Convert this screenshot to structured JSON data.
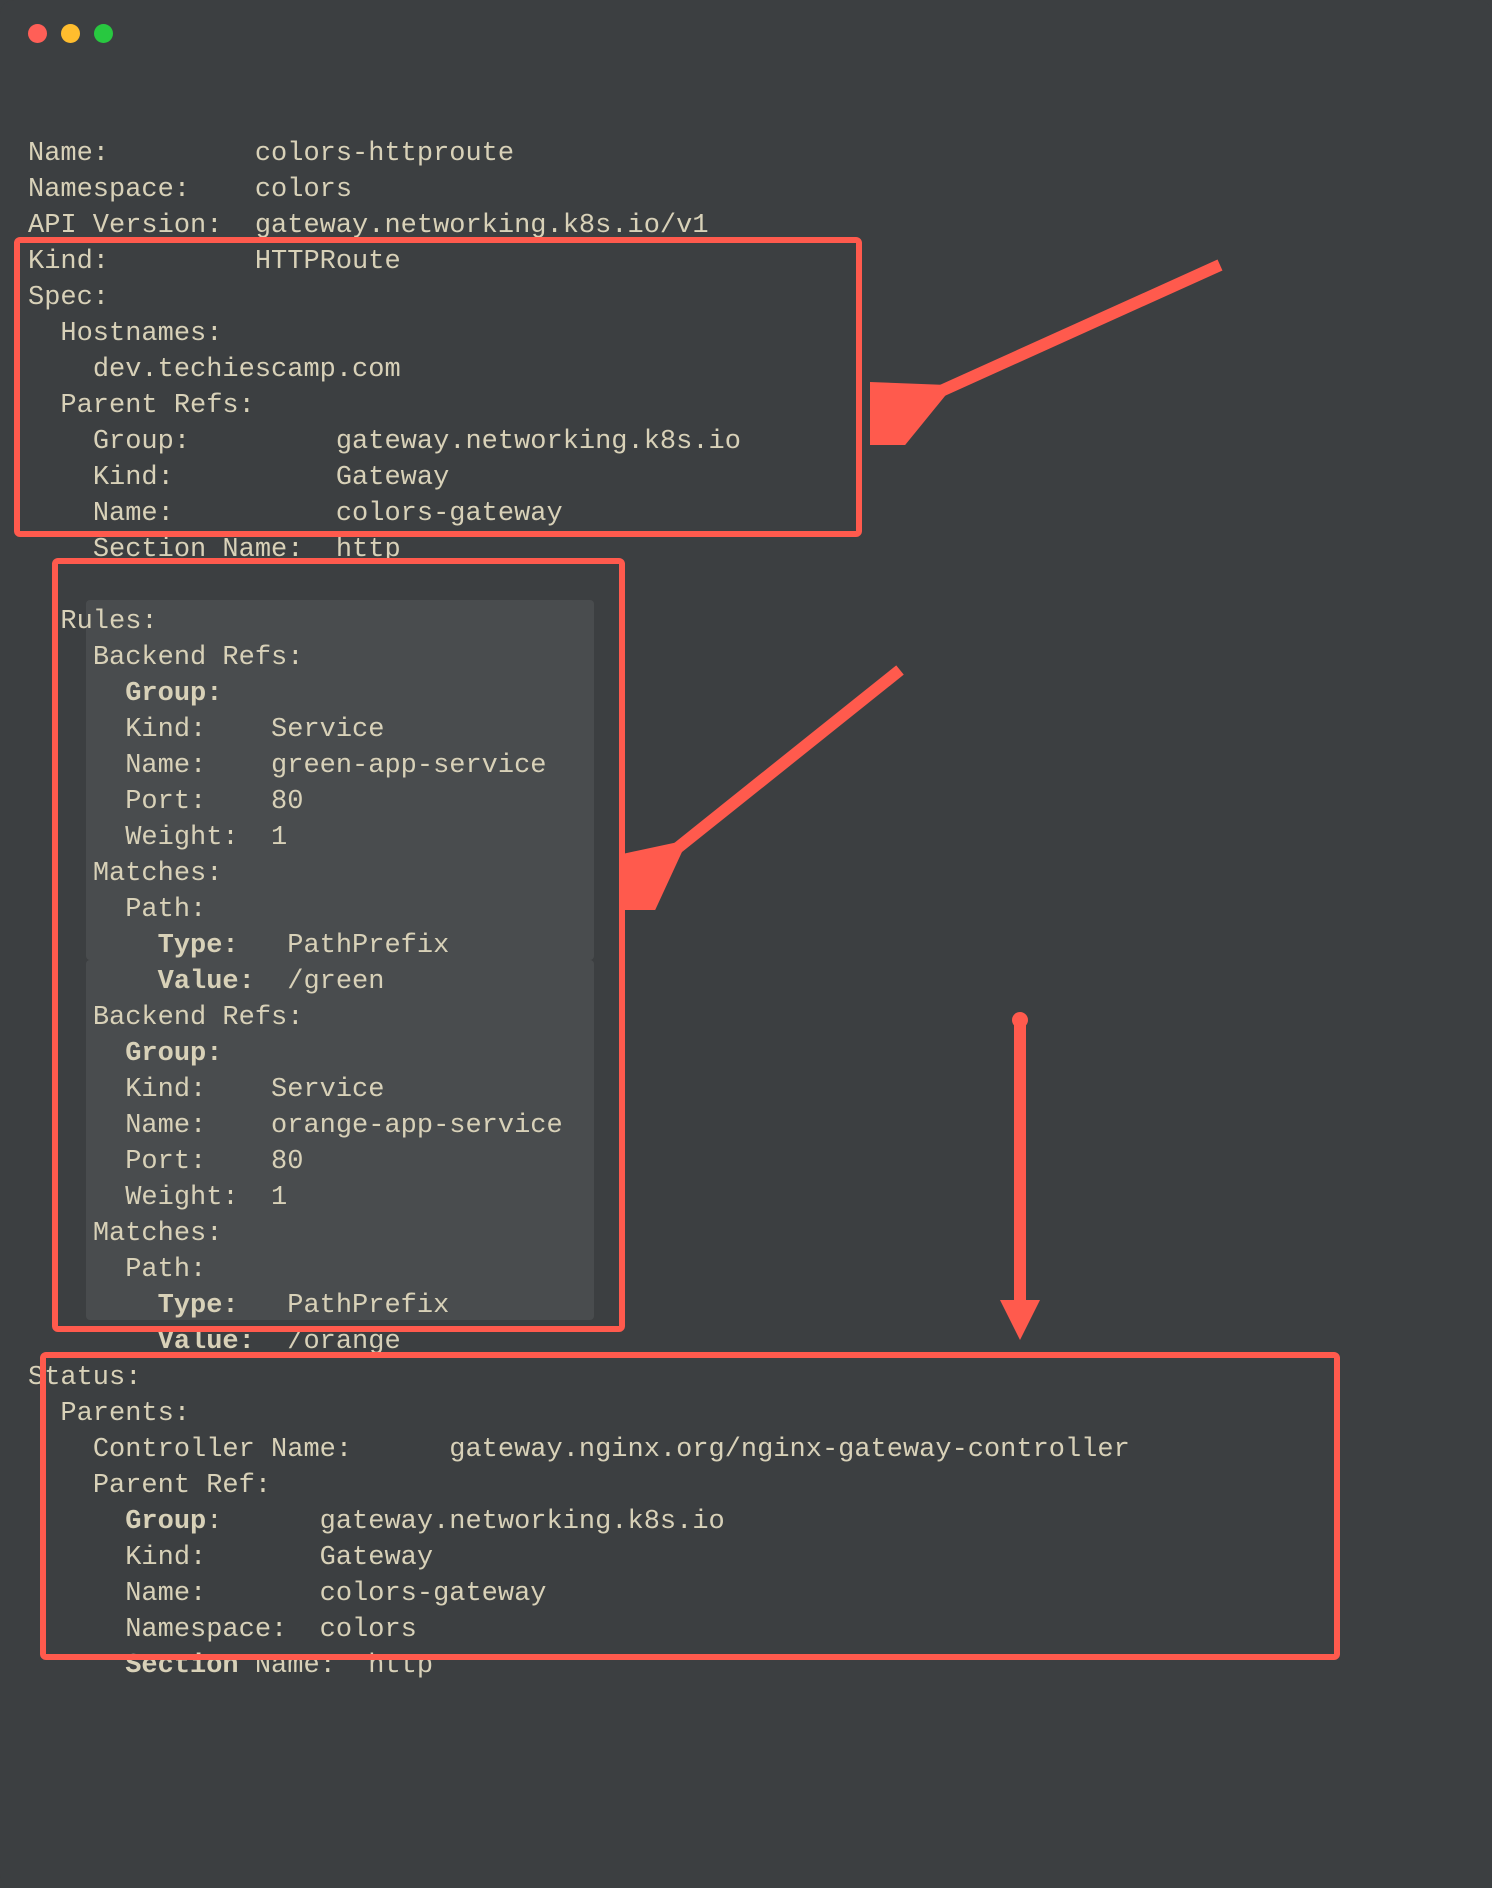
{
  "header": {
    "name_label": "Name:",
    "name_value": "colors-httproute",
    "namespace_label": "Namespace:",
    "namespace_value": "colors",
    "api_version_label": "API Version:",
    "api_version_value": "gateway.networking.k8s.io/v1",
    "kind_label": "Kind:",
    "kind_value": "HTTPRoute"
  },
  "spec": {
    "title": "Spec:",
    "hostnames_label": "Hostnames:",
    "hostnames_value": "dev.techiescamp.com",
    "parent_refs_label": "Parent Refs:",
    "parent_refs": {
      "group_label": "Group:",
      "group_value": "gateway.networking.k8s.io",
      "kind_label": "Kind:",
      "kind_value": "Gateway",
      "name_label": "Name:",
      "name_value": "colors-gateway",
      "section_name_label": "Section Name:",
      "section_name_value": "http"
    }
  },
  "rules": {
    "title": "Rules:",
    "items": [
      {
        "backend_refs_label": "Backend Refs:",
        "group_label": "Group:",
        "kind_label": "Kind:",
        "kind_value": "Service",
        "name_label": "Name:",
        "name_value": "green-app-service",
        "port_label": "Port:",
        "port_value": "80",
        "weight_label": "Weight:",
        "weight_value": "1",
        "matches_label": "Matches:",
        "path_label": "Path:",
        "type_label": "Type:",
        "type_value": "PathPrefix",
        "value_label": "Value:",
        "value_value": "/green"
      },
      {
        "backend_refs_label": "Backend Refs:",
        "group_label": "Group:",
        "kind_label": "Kind:",
        "kind_value": "Service",
        "name_label": "Name:",
        "name_value": "orange-app-service",
        "port_label": "Port:",
        "port_value": "80",
        "weight_label": "Weight:",
        "weight_value": "1",
        "matches_label": "Matches:",
        "path_label": "Path:",
        "type_label": "Type:",
        "type_value": "PathPrefix",
        "value_label": "Value:",
        "value_value": "/orange"
      }
    ]
  },
  "status": {
    "title": "Status:",
    "parents_label": "Parents:",
    "controller_name_label": "Controller Name:",
    "controller_name_value": "gateway.nginx.org/nginx-gateway-controller",
    "parent_ref_label": "Parent Ref:",
    "parent_ref": {
      "group_label": "Group",
      "group_colon": ":",
      "group_value": "gateway.networking.k8s.io",
      "kind_label": "Kind:",
      "kind_value": "Gateway",
      "name_label": "Name:",
      "name_value": "colors-gateway",
      "namespace_label": "Namespace:",
      "namespace_value": "colors",
      "section_label": "Section",
      "section_rest": " Name:",
      "section_value": "http"
    }
  },
  "annotations": {
    "spec_box": {
      "purpose": "highlight-spec"
    },
    "rules_box": {
      "purpose": "highlight-rules"
    },
    "status_box": {
      "purpose": "highlight-status"
    }
  }
}
